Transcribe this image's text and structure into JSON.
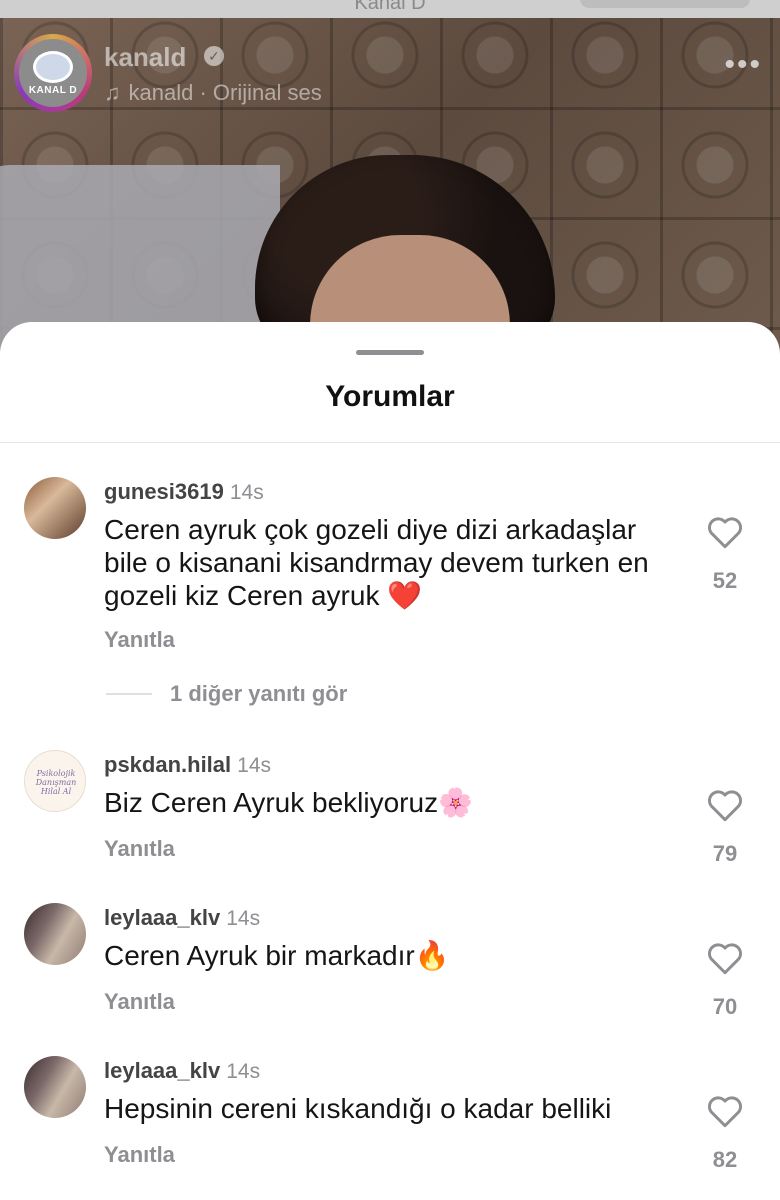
{
  "status": {
    "top_label": "Kanal D"
  },
  "channel": {
    "name": "kanald",
    "logo_text": "KANAL D",
    "sound": "kanald · Orijinal ses"
  },
  "sheet": {
    "title": "Yorumlar"
  },
  "comments": [
    {
      "username": "gunesi3619",
      "time": "14s",
      "text_lines": [
        "Ceren ayruk çok gozeli diye dizi arkadaşlar",
        "bile o kisanani kisandrmay devem turken en",
        "gozeli kiz Ceren ayruk ❤️"
      ],
      "reply": "Yanıtla",
      "likes": "52",
      "more_replies": "1 diğer yanıtı gör"
    },
    {
      "username": "pskdan.hilal",
      "time": "14s",
      "avatar_text": "Psikolojik Danışman Hilal Al",
      "text": "Biz Ceren Ayruk bekliyoruz🌸",
      "reply": "Yanıtla",
      "likes": "79"
    },
    {
      "username": "leylaaa_klv",
      "time": "14s",
      "text": "Ceren Ayruk bir markadır🔥",
      "reply": "Yanıtla",
      "likes": "70"
    },
    {
      "username": "leylaaa_klv",
      "time": "14s",
      "text": "Hepsinin cereni kıskandığı o kadar belliki",
      "reply": "Yanıtla",
      "likes": "82"
    }
  ],
  "colors": {
    "sheet_bg": "#ffffff",
    "muted_text": "#8e8e93",
    "primary_text": "#151515",
    "heart_outline": "#8e8e93"
  },
  "icons": [
    "verified-icon",
    "music-note-icon",
    "more-options-icon",
    "heart-icon"
  ]
}
